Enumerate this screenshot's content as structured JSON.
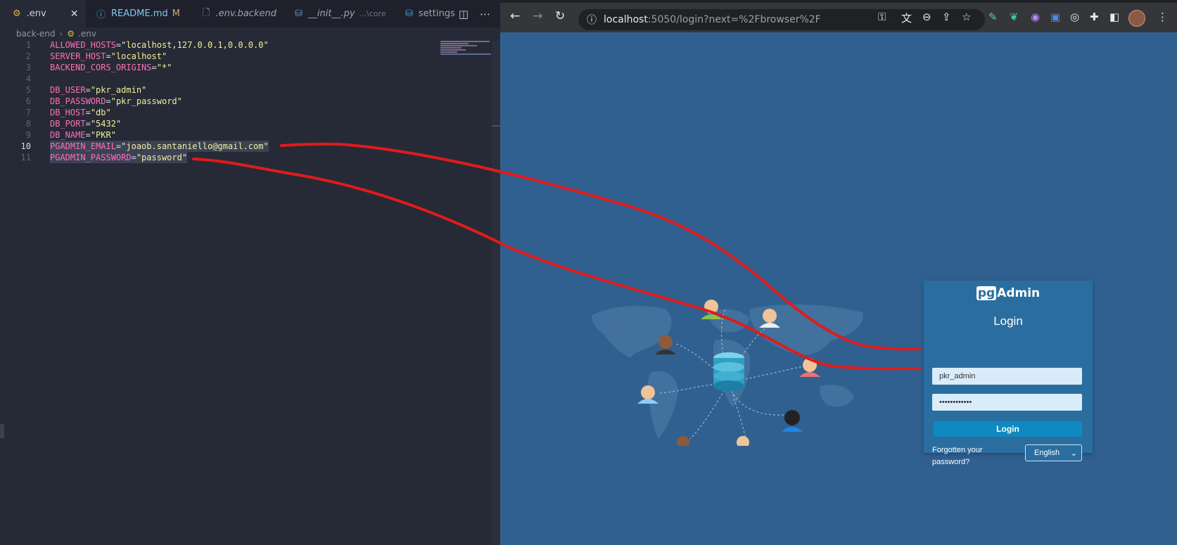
{
  "vscode": {
    "tabs": [
      {
        "label": ".env",
        "icon": "settings-file-icon",
        "active": true
      },
      {
        "label": "README.md",
        "icon": "info-icon",
        "badge": "M"
      },
      {
        "label": ".env.backend",
        "icon": "file-icon"
      },
      {
        "label": "__init__.py",
        "icon": "python-icon",
        "detail": "...\\core"
      },
      {
        "label": "settings.p",
        "icon": "python-icon"
      }
    ],
    "breadcrumb": {
      "folder": "back-end",
      "file": ".env"
    },
    "lines": [
      {
        "n": "1",
        "key": "ALLOWED_HOSTS",
        "value": "\"localhost,127.0.0.1,0.0.0.0\""
      },
      {
        "n": "2",
        "key": "SERVER_HOST",
        "value": "\"localhost\""
      },
      {
        "n": "3",
        "key": "BACKEND_CORS_ORIGINS",
        "value": "\"*\""
      },
      {
        "n": "4",
        "key": "",
        "value": ""
      },
      {
        "n": "5",
        "key": "DB_USER",
        "value": "\"pkr_admin\""
      },
      {
        "n": "6",
        "key": "DB_PASSWORD",
        "value": "\"pkr_password\""
      },
      {
        "n": "7",
        "key": "DB_HOST",
        "value": "\"db\""
      },
      {
        "n": "8",
        "key": "DB_PORT",
        "value": "\"5432\""
      },
      {
        "n": "9",
        "key": "DB_NAME",
        "value": "\"PKR\""
      },
      {
        "n": "10",
        "key": "PGADMIN_EMAIL",
        "value": "\"joaob.santaniello@gmail.com\""
      },
      {
        "n": "11",
        "key": "PGADMIN_PASSWORD",
        "value": "\"password\""
      }
    ],
    "current_line": "10"
  },
  "browser": {
    "url_host": "localhost",
    "url_rest": ":5050/login?next=%2Fbrowser%2F"
  },
  "login": {
    "logo_pg": "pg",
    "logo_rest": "Admin",
    "title": "Login",
    "email_value": "pkr_admin",
    "password_value": "••••••••••••",
    "button_label": "Login",
    "forgot_label": "Forgotten your password?",
    "language": "English"
  },
  "colors": {
    "annotation": "#e01b1b",
    "pgadmin_bg": "#306090",
    "card_bg": "#2a6ea0",
    "key_color": "#ff6fb5",
    "value_color": "#f1ef9a"
  }
}
